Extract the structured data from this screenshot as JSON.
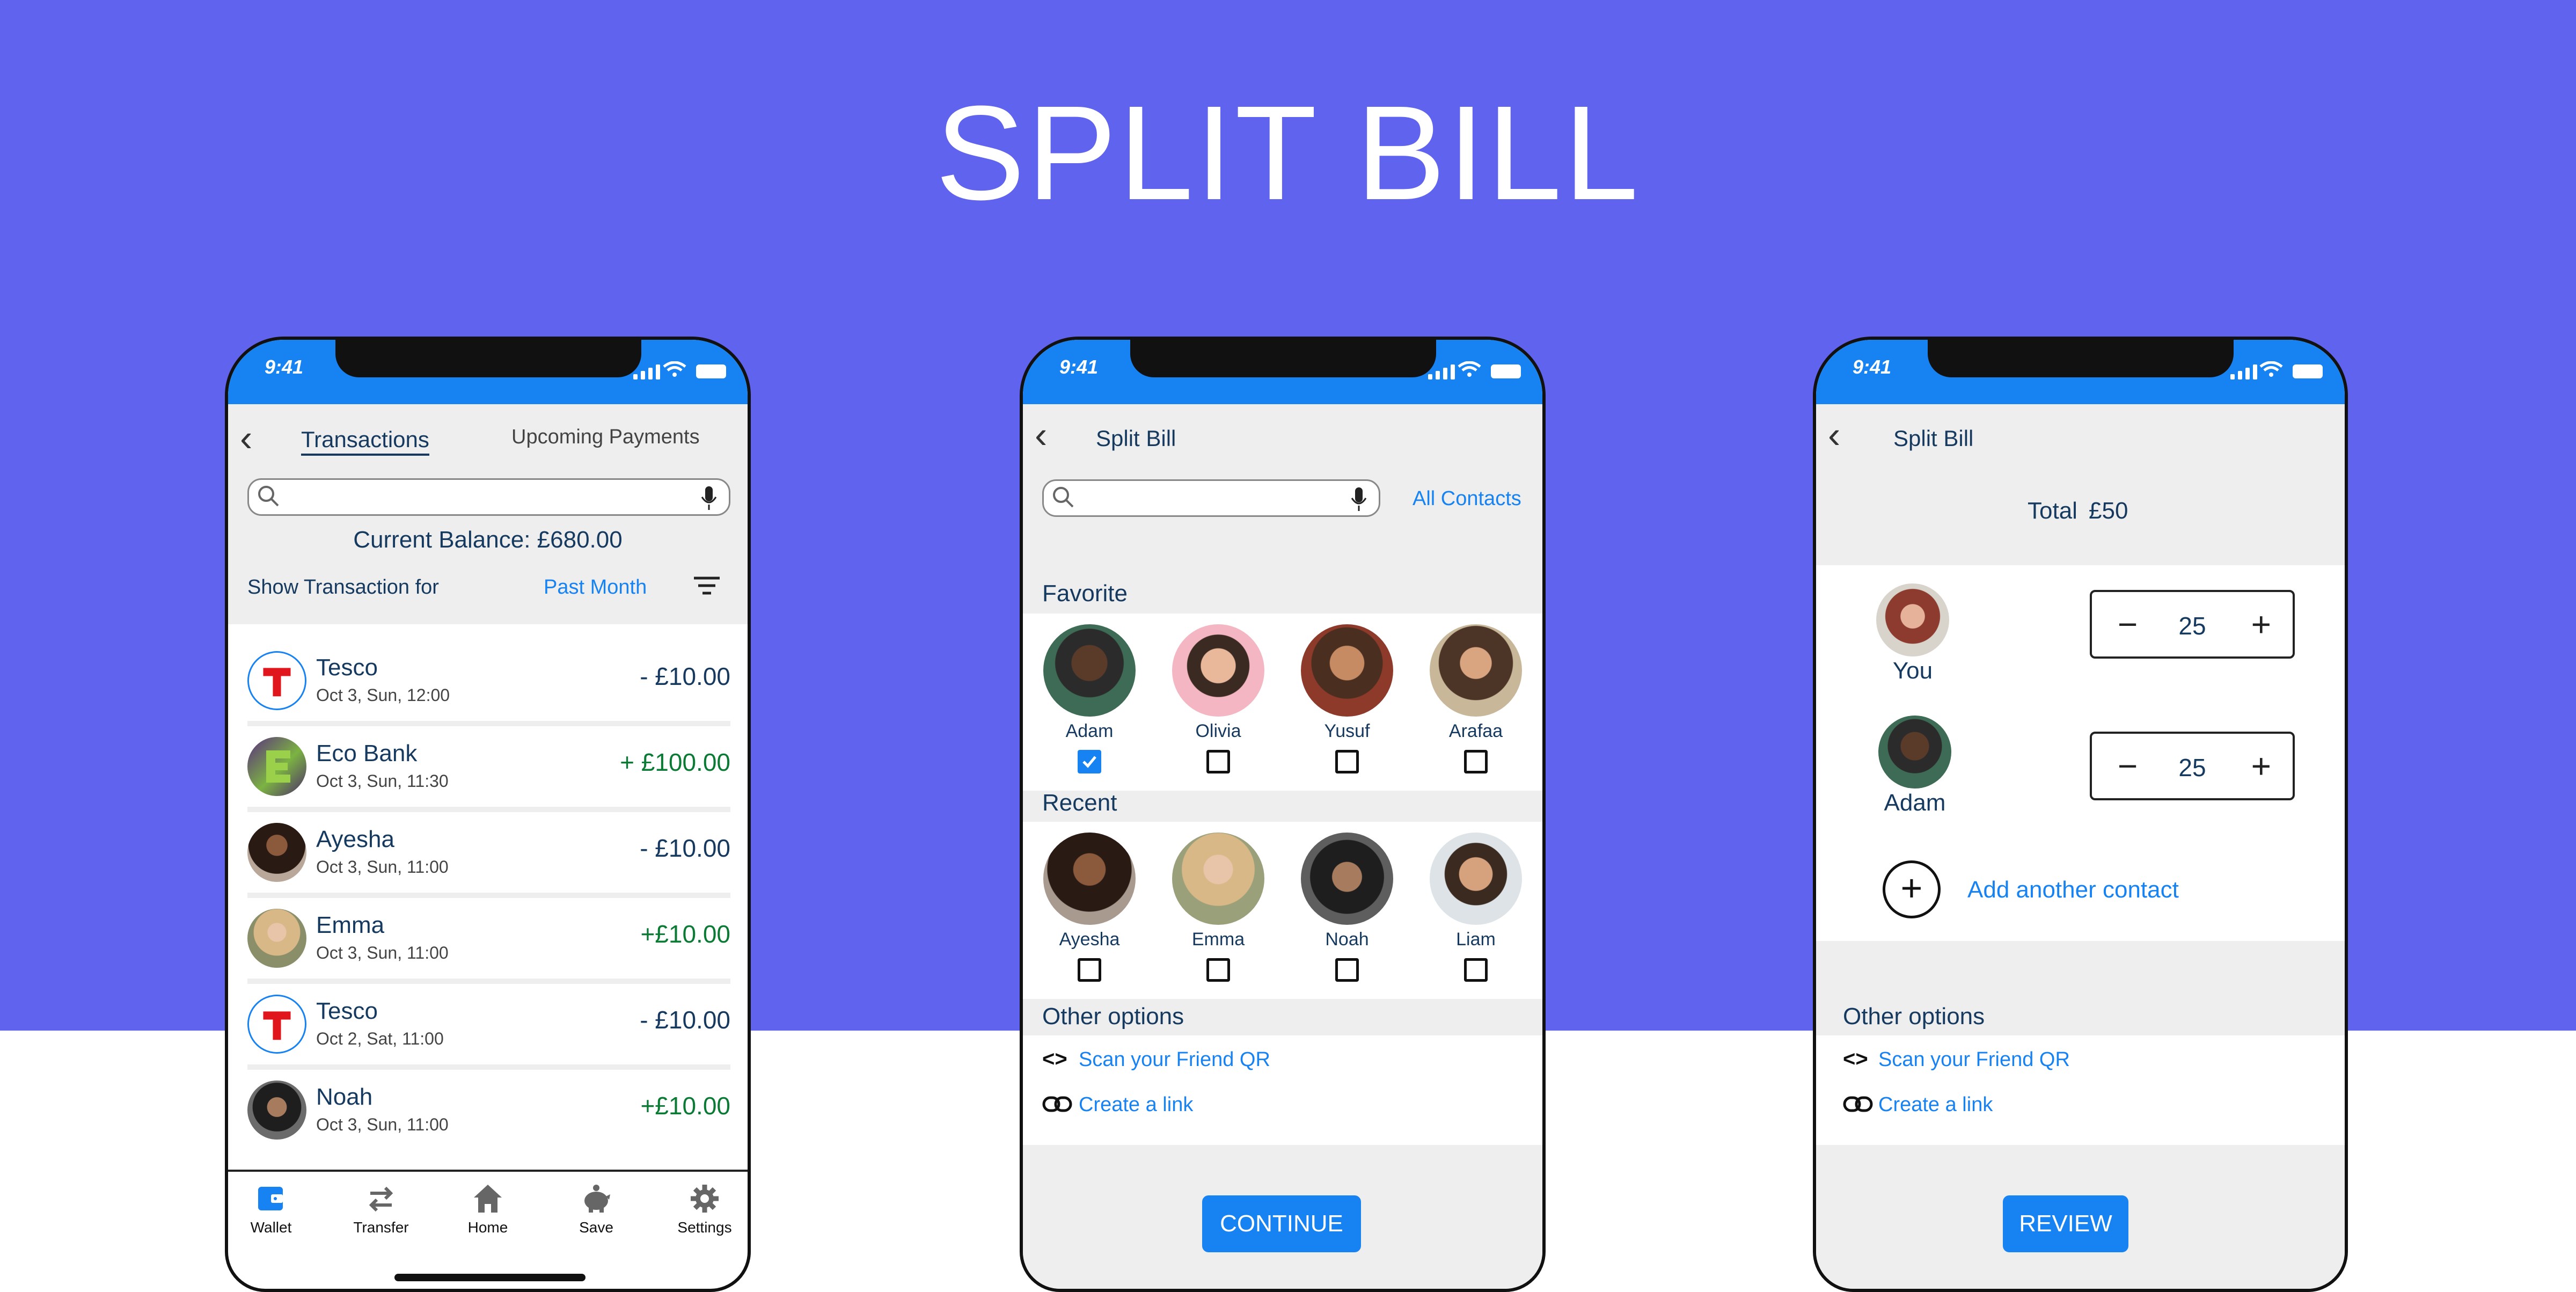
{
  "page": {
    "title": "SPLIT BILL",
    "bg_color": "#5F63EE",
    "accent_color": "#1782F1"
  },
  "status_time": "9:41",
  "screen1": {
    "tabs": [
      "Transactions",
      "Upcoming Payments"
    ],
    "balance": "Current Balance: £680.00",
    "filter_label": "Show Transaction for",
    "filter_value": "Past Month",
    "transactions": [
      {
        "name": "Tesco",
        "date": "Oct 3, Sun, 12:00",
        "amount": "- £10.00",
        "type": "debit",
        "avatar": "tesco-logo"
      },
      {
        "name": "Eco Bank",
        "date": "Oct 3, Sun, 11:30",
        "amount": "+ £100.00",
        "type": "credit",
        "avatar": "eco-bank-logo"
      },
      {
        "name": "Ayesha",
        "date": "Oct 3, Sun, 11:00",
        "amount": "- £10.00",
        "type": "debit",
        "avatar": "photo"
      },
      {
        "name": "Emma",
        "date": "Oct 3, Sun, 11:00",
        "amount": "+£10.00",
        "type": "credit",
        "avatar": "photo"
      },
      {
        "name": "Tesco",
        "date": "Oct 2, Sat, 11:00",
        "amount": "- £10.00",
        "type": "debit",
        "avatar": "tesco-logo"
      },
      {
        "name": "Noah",
        "date": "Oct 3, Sun, 11:00",
        "amount": "+£10.00",
        "type": "credit",
        "avatar": "photo"
      }
    ],
    "nav": [
      {
        "label": "Wallet",
        "icon": "wallet-icon",
        "active": true
      },
      {
        "label": "Transfer",
        "icon": "transfer-icon",
        "active": false
      },
      {
        "label": "Home",
        "icon": "home-icon",
        "active": false
      },
      {
        "label": "Save",
        "icon": "piggy-bank-icon",
        "active": false
      },
      {
        "label": "Settings",
        "icon": "gear-icon",
        "active": false
      }
    ]
  },
  "screen2": {
    "title": "Split Bill",
    "all_contacts": "All Contacts",
    "favorite_heading": "Favorite",
    "favorites": [
      {
        "name": "Adam",
        "checked": true
      },
      {
        "name": "Olivia",
        "checked": false
      },
      {
        "name": "Yusuf",
        "checked": false
      },
      {
        "name": "Arafaa",
        "checked": false
      }
    ],
    "recent_heading": "Recent",
    "recents": [
      {
        "name": "Ayesha",
        "checked": false
      },
      {
        "name": "Emma",
        "checked": false
      },
      {
        "name": "Noah",
        "checked": false
      },
      {
        "name": "Liam",
        "checked": false
      }
    ],
    "other_heading": "Other options",
    "scan_qr": "Scan your Friend QR",
    "create_link": "Create a link",
    "continue": "CONTINUE"
  },
  "screen3": {
    "title": "Split Bill",
    "total_label": "Total",
    "total_value": "£50",
    "participants": [
      {
        "name": "You",
        "amount": "25"
      },
      {
        "name": "Adam",
        "amount": "25"
      }
    ],
    "add_contact": "Add another contact",
    "other_heading": "Other options",
    "scan_qr": "Scan your Friend QR",
    "create_link": "Create a link",
    "review": "REVIEW"
  }
}
